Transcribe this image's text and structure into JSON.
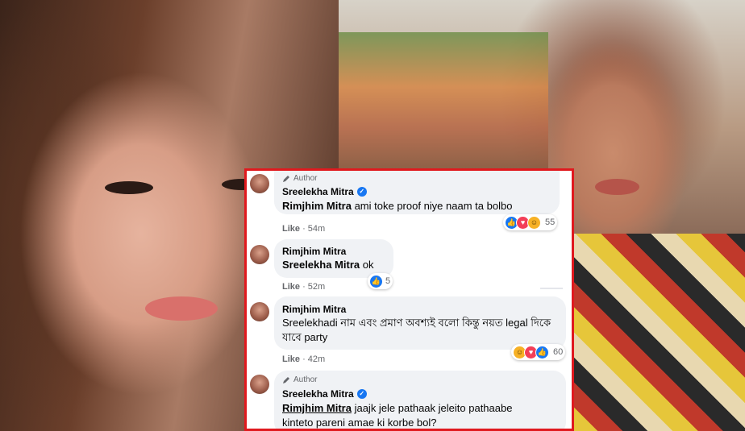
{
  "comments": [
    {
      "author_badge": "Author",
      "name": "Sreelekha Mitra",
      "verified": true,
      "mention": "Rimjhim Mitra",
      "text": " ami toke proof niye naam ta bolbo",
      "like_label": "Like",
      "time": "54m",
      "reaction_count": "55",
      "reactions": [
        "like-icon",
        "love-icon",
        "haha-icon"
      ]
    },
    {
      "name": "Rimjhim Mitra",
      "mention": "Sreelekha Mitra",
      "text": " ok",
      "like_label": "Like",
      "time": "52m",
      "reaction_count": "5",
      "reactions": [
        "like-icon"
      ]
    },
    {
      "name": "Rimjhim Mitra",
      "mention": "Sreelekha",
      "text": "di নাম এবং প্রমাণ অবশ্যই বলো কিন্তু নয়ত legal দিকে যাবে party",
      "like_label": "Like",
      "time": "42m",
      "reaction_count": "60",
      "reactions": [
        "haha-icon",
        "love-icon",
        "like-icon"
      ]
    },
    {
      "author_badge": "Author",
      "name": "Sreelekha Mitra",
      "verified": true,
      "mention": "Rimjhim Mitra",
      "text": " jaajk jele pathaak jeleito pathaabe kinteto pareni amae ki korbe bol?"
    }
  ],
  "colors": {
    "highlight_border": "#e0191e",
    "bubble": "#f0f2f5",
    "link_blue": "#1877f2"
  }
}
